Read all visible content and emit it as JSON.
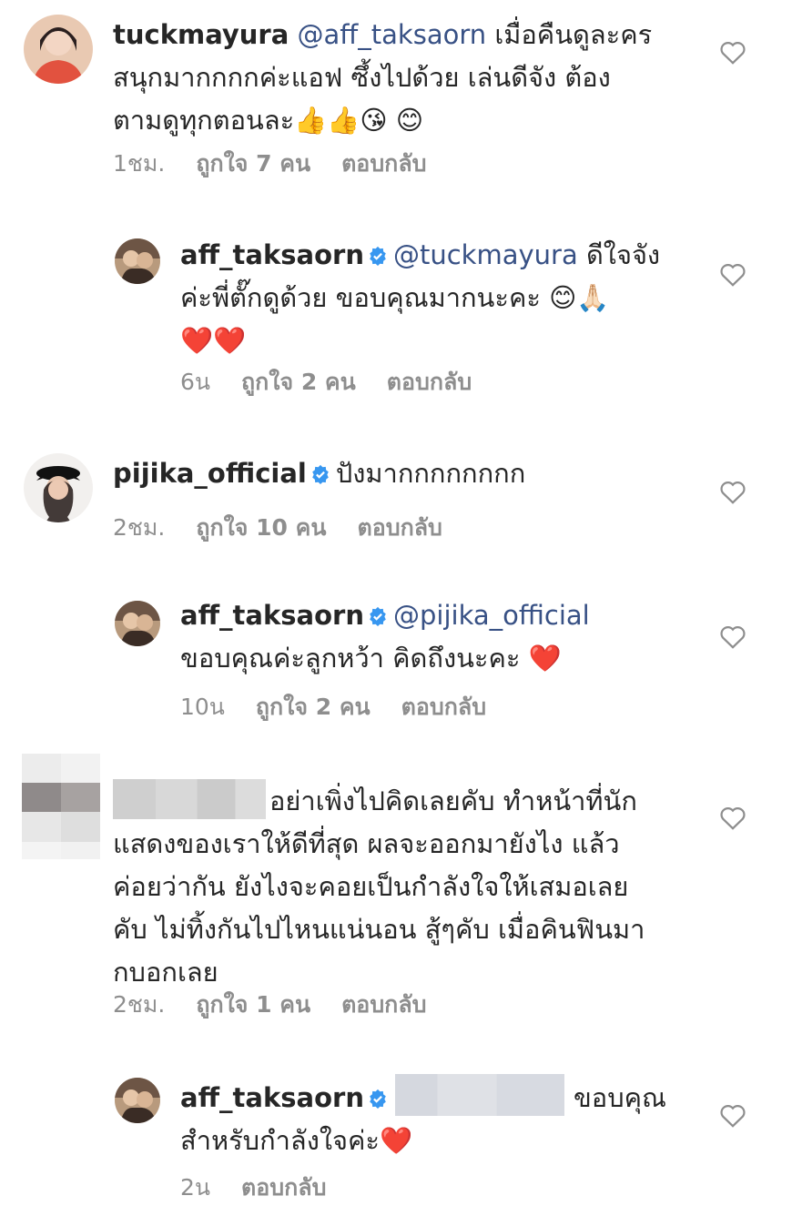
{
  "comments": [
    {
      "user": "tuckmayura",
      "lines": [
        {
          "mention": "@aff_taksaorn",
          "text": " เมื่อคืนดูละคร"
        },
        {
          "text": "สนุกมากกกกค่ะแอฟ  ซึ้งไปด้วย เล่นดีจัง ต้อง"
        },
        {
          "text": "ตามดูทุกตอนละ",
          "emoji": "👍👍😘 😊"
        }
      ],
      "time": "1ชม.",
      "likes": "ถูกใจ 7 คน",
      "reply": "ตอบกลับ"
    },
    {
      "user": "aff_taksaorn",
      "mention": "@tuckmayura",
      "lines": [
        {
          "text": " ดีใจจัง"
        },
        {
          "text": "ค่ะพี่ตั๊กดูด้วย ขอบคุณมากนะคะ ",
          "emoji": "😊🙏🏻"
        },
        {
          "emoji": "❤️❤️"
        }
      ],
      "time": "6น",
      "likes": "ถูกใจ 2 คน",
      "reply": "ตอบกลับ"
    },
    {
      "user": "pijika_official",
      "text": "ปังมากกกกกกกก",
      "time": "2ชม.",
      "likes": "ถูกใจ 10 คน",
      "reply": "ตอบกลับ"
    },
    {
      "user": "aff_taksaorn",
      "mention": "@pijika_official",
      "line2": "ขอบคุณค่ะลูกหว้า คิดถึงนะคะ ",
      "emoji": "❤️",
      "time": "10น",
      "likes": "ถูกใจ 2 คน",
      "reply": "ตอบกลับ"
    },
    {
      "lines": [
        "อย่าเพิ่งไปคิดเลยคับ ทำหน้าที่นัก",
        "แสดงของเราให้ดีที่สุด ผลจะออกมายังไง แล้ว",
        "ค่อยว่ากัน ยังไงจะคอยเป็นกำลังใจให้เสมอเลย",
        "คับ ไม่ทิ้งกันไปไหนแน่นอน สู้ๆคับ เมื่อคินฟินมา",
        "กบอกเลย"
      ],
      "time": "2ชม.",
      "likes": "ถูกใจ 1 คน",
      "reply": "ตอบกลับ"
    },
    {
      "user": "aff_taksaorn",
      "line1": "ขอบคุณ",
      "line2": "สำหรับกำลังใจค่ะ",
      "emoji": "❤️",
      "time": "2น",
      "reply": "ตอบกลับ"
    }
  ],
  "colors": {
    "link": "#385185",
    "meta": "#8e8e8e",
    "verified": "#3897f0"
  }
}
